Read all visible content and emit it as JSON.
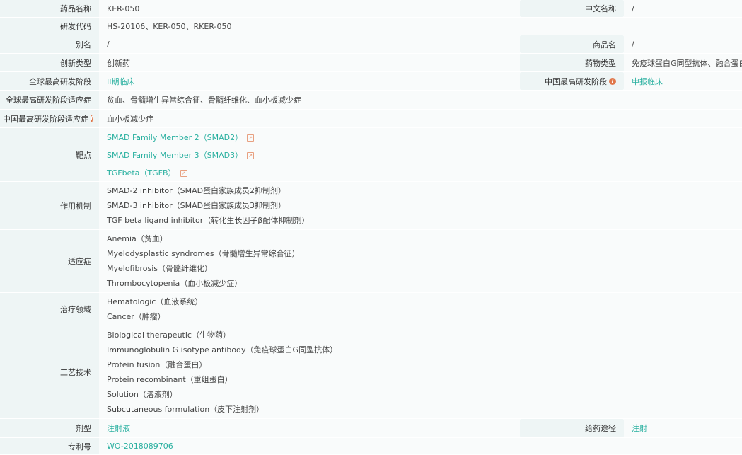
{
  "rows": {
    "drug_name": {
      "label": "药品名称",
      "value": "KER-050",
      "right_label": "中文名称",
      "right_value": "/"
    },
    "dev_code": {
      "label": "研发代码",
      "value": "HS-20106、KER-050、RKER-050"
    },
    "alias": {
      "label": "别名",
      "value": "/",
      "right_label": "商品名",
      "right_value": "/"
    },
    "innovation": {
      "label": "创新类型",
      "value": "创新药",
      "right_label": "药物类型",
      "right_value": "免疫球蛋白G同型抗体、融合蛋白"
    },
    "global_phase": {
      "label": "全球最高研发阶段",
      "value": "II期临床",
      "right_label": "中国最高研发阶段",
      "right_value": "申报临床"
    },
    "global_indication": {
      "label": "全球最高研发阶段适应症",
      "value": "贫血、骨髓增生异常综合征、骨髓纤维化、血小板减少症"
    },
    "china_indication": {
      "label": "中国最高研发阶段适应症",
      "value": "血小板减少症"
    },
    "targets": {
      "label": "靶点",
      "items": [
        "SMAD Family Member 2（SMAD2）",
        "SMAD Family Member 3（SMAD3）",
        "TGFbeta（TGFB）"
      ]
    },
    "mechanism": {
      "label": "作用机制",
      "items": [
        "SMAD-2 inhibitor（SMAD蛋白家族成员2抑制剂）",
        "SMAD-3 inhibitor（SMAD蛋白家族成员3抑制剂）",
        "TGF beta ligand inhibitor（转化生长因子β配体抑制剂）"
      ]
    },
    "indications": {
      "label": "适应症",
      "items": [
        "Anemia（贫血）",
        "Myelodysplastic syndromes（骨髓增生异常综合征）",
        "Myelofibrosis（骨髓纤维化）",
        "Thrombocytopenia（血小板减少症）"
      ]
    },
    "domains": {
      "label": "治疗领域",
      "items": [
        "Hematologic（血液系统）",
        "Cancer（肿瘤）"
      ]
    },
    "technology": {
      "label": "工艺技术",
      "items": [
        "Biological therapeutic（生物药）",
        "Immunoglobulin G isotype antibody（免疫球蛋白G同型抗体）",
        "Protein fusion（融合蛋白）",
        "Protein recombinant（重组蛋白）",
        "Solution（溶液剂）",
        "Subcutaneous formulation（皮下注射剂）"
      ]
    },
    "dosage_form": {
      "label": "剂型",
      "value": "注射液",
      "right_label": "给药途径",
      "right_value": "注射"
    },
    "patent": {
      "label": "专利号",
      "value": "WO-2018089706"
    }
  },
  "icons": {
    "info": "i",
    "external_link": "↗"
  },
  "colors": {
    "link": "#2ab0a0",
    "label_bg": "#eef5f5",
    "info": "#e0774a"
  }
}
